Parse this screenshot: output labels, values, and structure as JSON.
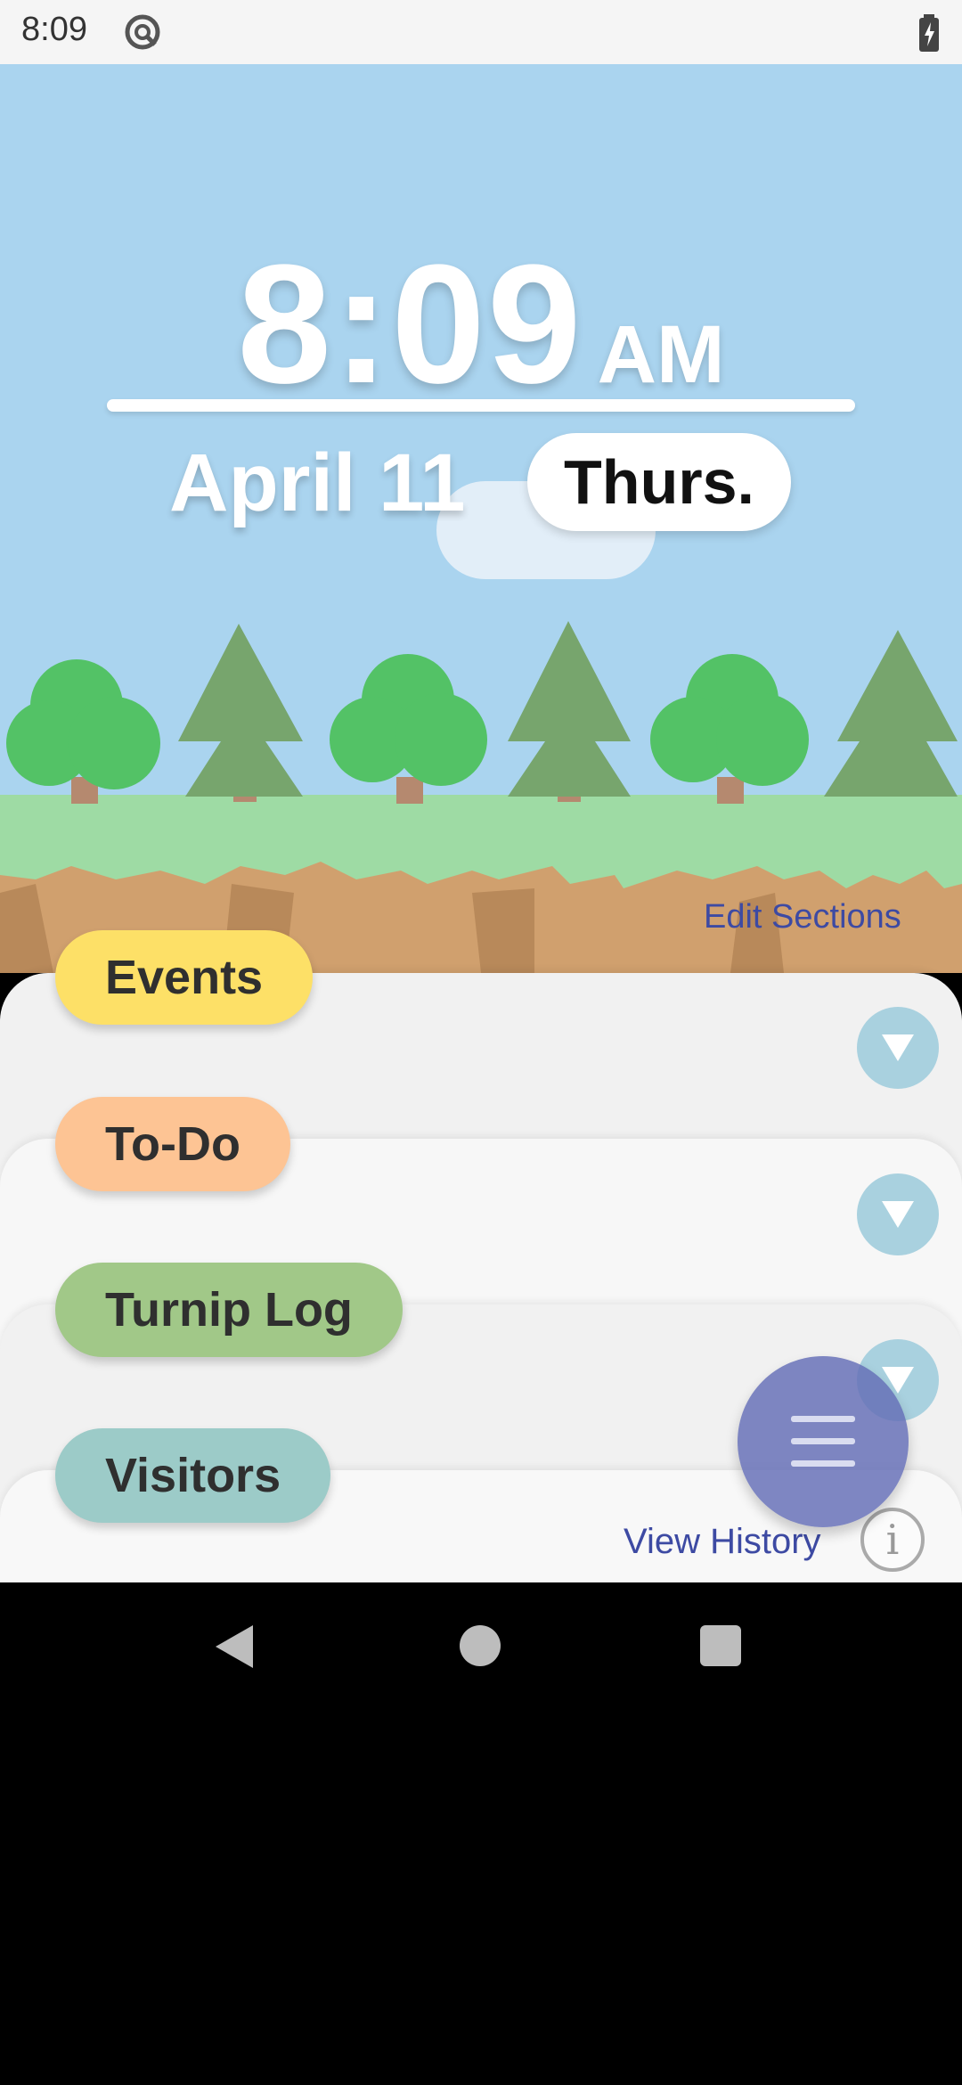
{
  "status_bar": {
    "time": "8:09",
    "sync_icon": "sync-icon",
    "battery_icon": "battery-charging-icon"
  },
  "clock": {
    "time": "8:09",
    "ampm": "AM",
    "date": "April 11",
    "day": "Thurs."
  },
  "scene": {
    "sky_color": "#aad4ef",
    "grass_color": "#9edba4",
    "dirt_color": "#d0a06e",
    "round_tree_color": "#53c266",
    "pine_tree_color": "#77a56d"
  },
  "edit_sections_label": "Edit Sections",
  "sections": [
    {
      "label": "Events",
      "color": "#fde067"
    },
    {
      "label": "To-Do",
      "color": "#fdc494"
    },
    {
      "label": "Turnip Log",
      "color": "#a1c888"
    },
    {
      "label": "Visitors",
      "color": "#9ccbc8"
    }
  ],
  "view_history_label": "View History",
  "info_label": "i",
  "fab_icon": "menu-icon",
  "nav": {
    "back_icon": "back-icon",
    "home_icon": "home-icon",
    "recents_icon": "recents-icon"
  }
}
